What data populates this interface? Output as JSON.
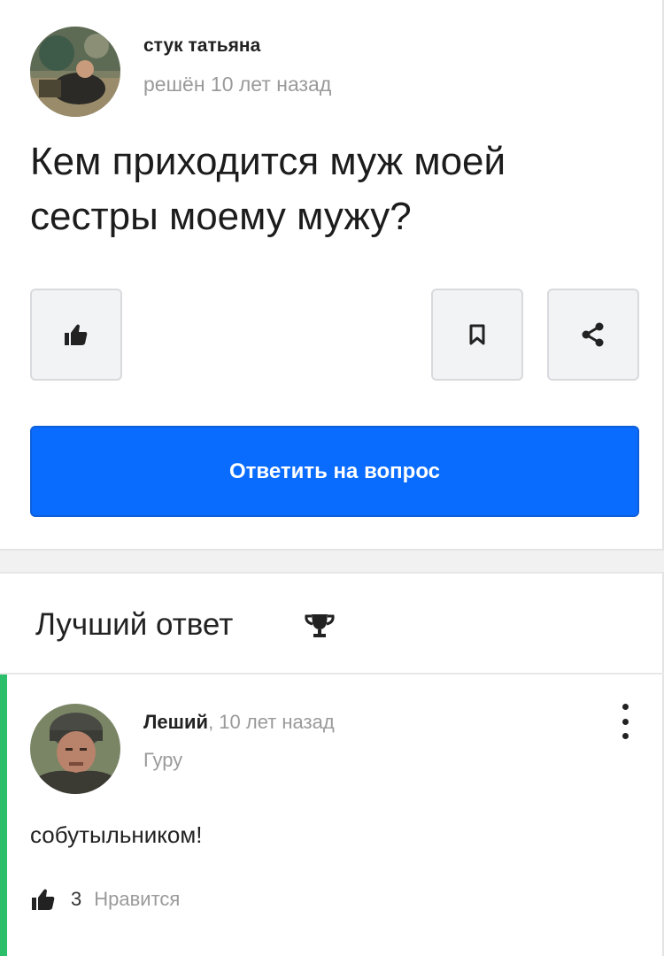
{
  "question": {
    "author_name": "стук татьяна",
    "status": "решён 10 лет назад",
    "title": "Кем приходится муж моей сестры моему мужу?",
    "avatar_icon": "user-avatar-photo",
    "actions": {
      "like_icon": "thumbs-up-icon",
      "bookmark_icon": "bookmark-icon",
      "share_icon": "share-icon"
    },
    "answer_button_label": "Ответить на вопрос"
  },
  "best_answer": {
    "header": "Лучший ответ",
    "header_icon": "trophy-icon",
    "author_name": "Леший",
    "time": ", 10 лет назад",
    "rank": "Гуру",
    "text": "собутыльником!",
    "likes_count": "3",
    "like_label": "Нравится",
    "menu_icon": "more-vertical-icon"
  },
  "colors": {
    "accent": "#0a6cff",
    "best_answer_bar": "#2bbf6a",
    "muted_text": "#9a9a9a"
  }
}
